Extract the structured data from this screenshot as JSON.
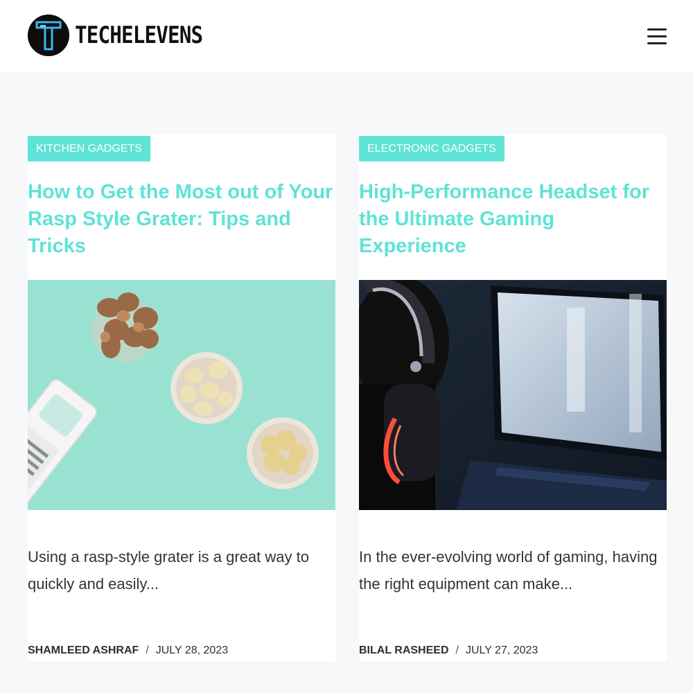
{
  "site": {
    "brand": "TECHELEVENS",
    "logo_letter": "T"
  },
  "colors": {
    "accent": "#5ee3d7",
    "background": "#f6f8fa",
    "header": "#ffffff",
    "text": "#333333"
  },
  "icons": {
    "menu": "hamburger-icon",
    "logo": "logo-icon"
  },
  "posts": [
    {
      "category": "Kitchen Gadgets",
      "title": "How to Get the Most out of Your Rasp Style Grater: Tips and Tricks",
      "excerpt": "Using a rasp-style grater is a great way to quickly and easily...",
      "author": "Shamleed Ashraf",
      "separator": "/",
      "date": "July 28, 2023"
    },
    {
      "category": "Electronic Gadgets",
      "title": "High-Performance Headset for the Ultimate Gaming Experience",
      "excerpt": "In the ever-evolving world of gaming, having the right equipment can make...",
      "author": "Bilal Rasheed",
      "separator": "/",
      "date": "July 27, 2023"
    }
  ]
}
